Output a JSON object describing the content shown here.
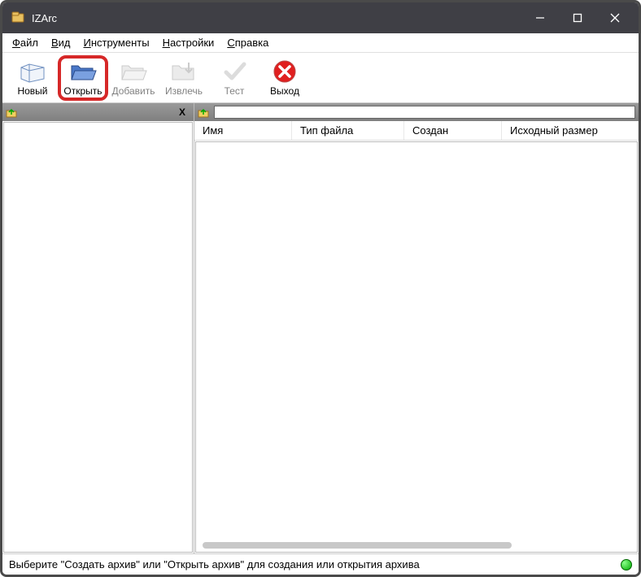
{
  "window": {
    "title": "IZArc"
  },
  "menu": {
    "file": "Файл",
    "view": "Вид",
    "tools": "Инструменты",
    "settings": "Настройки",
    "help": "Справка"
  },
  "toolbar": {
    "new": "Новый",
    "open": "Открыть",
    "add": "Добавить",
    "extract": "Извлечь",
    "test": "Тест",
    "exit": "Выход"
  },
  "left_pane": {
    "close_label": "X"
  },
  "columns": {
    "name": "Имя",
    "type": "Тип файла",
    "created": "Создан",
    "orig_size": "Исходный размер"
  },
  "status": {
    "text": "Выберите \"Создать архив\" или \"Открыть архив\" для создания или открытия архива"
  }
}
